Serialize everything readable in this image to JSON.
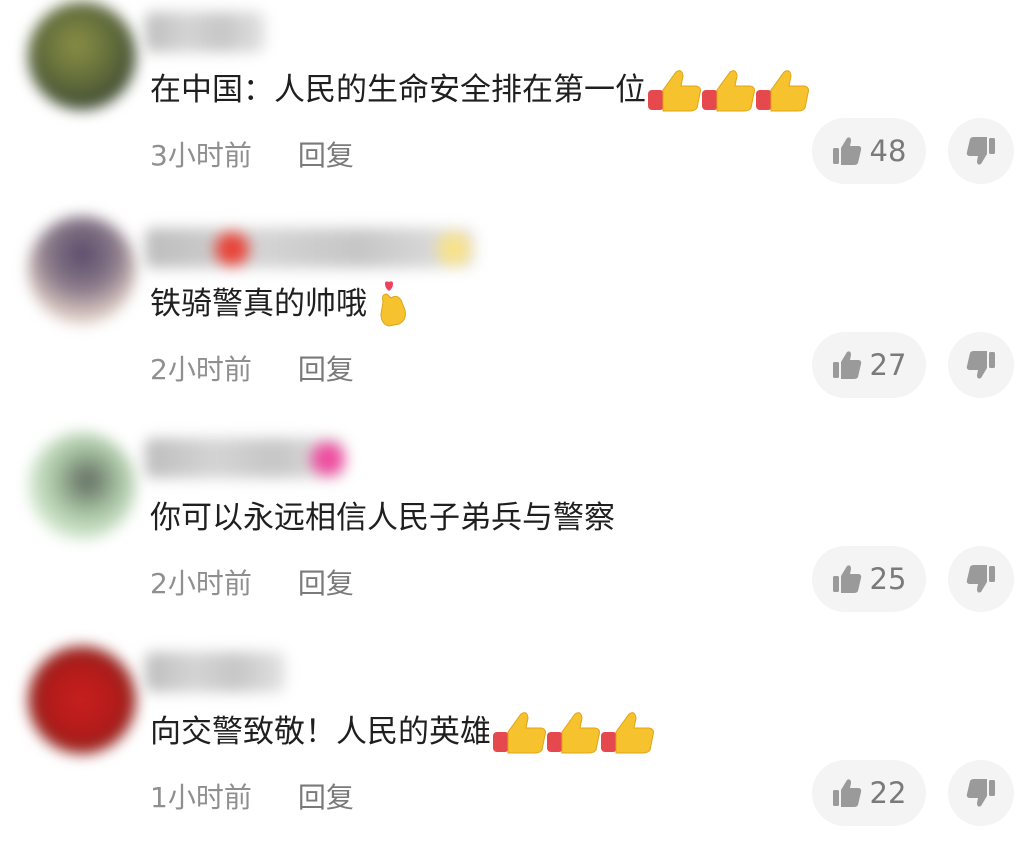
{
  "comments": [
    {
      "text": "在中国：人民的生命安全排在第一位",
      "emojis": [
        "thumbs-up",
        "thumbs-up",
        "thumbs-up"
      ],
      "time": "3小时前",
      "reply_label": "回复",
      "likes": "48"
    },
    {
      "text": "铁骑警真的帅哦",
      "emojis": [
        "finger-heart"
      ],
      "time": "2小时前",
      "reply_label": "回复",
      "likes": "27"
    },
    {
      "text": "你可以永远相信人民子弟兵与警察",
      "emojis": [],
      "time": "2小时前",
      "reply_label": "回复",
      "likes": "25"
    },
    {
      "text": "向交警致敬！人民的英雄",
      "emojis": [
        "thumbs-up",
        "thumbs-up",
        "thumbs-up"
      ],
      "time": "1小时前",
      "reply_label": "回复",
      "likes": "22"
    }
  ],
  "icons": {
    "like": "thumbs-up-outline-icon",
    "dislike": "thumbs-down-icon"
  },
  "colors": {
    "meta_text": "#8f8f8f",
    "pill_background": "#f4f4f4",
    "emoji_yellow": "#f6c22d",
    "emoji_cuff": "#e5484d"
  }
}
